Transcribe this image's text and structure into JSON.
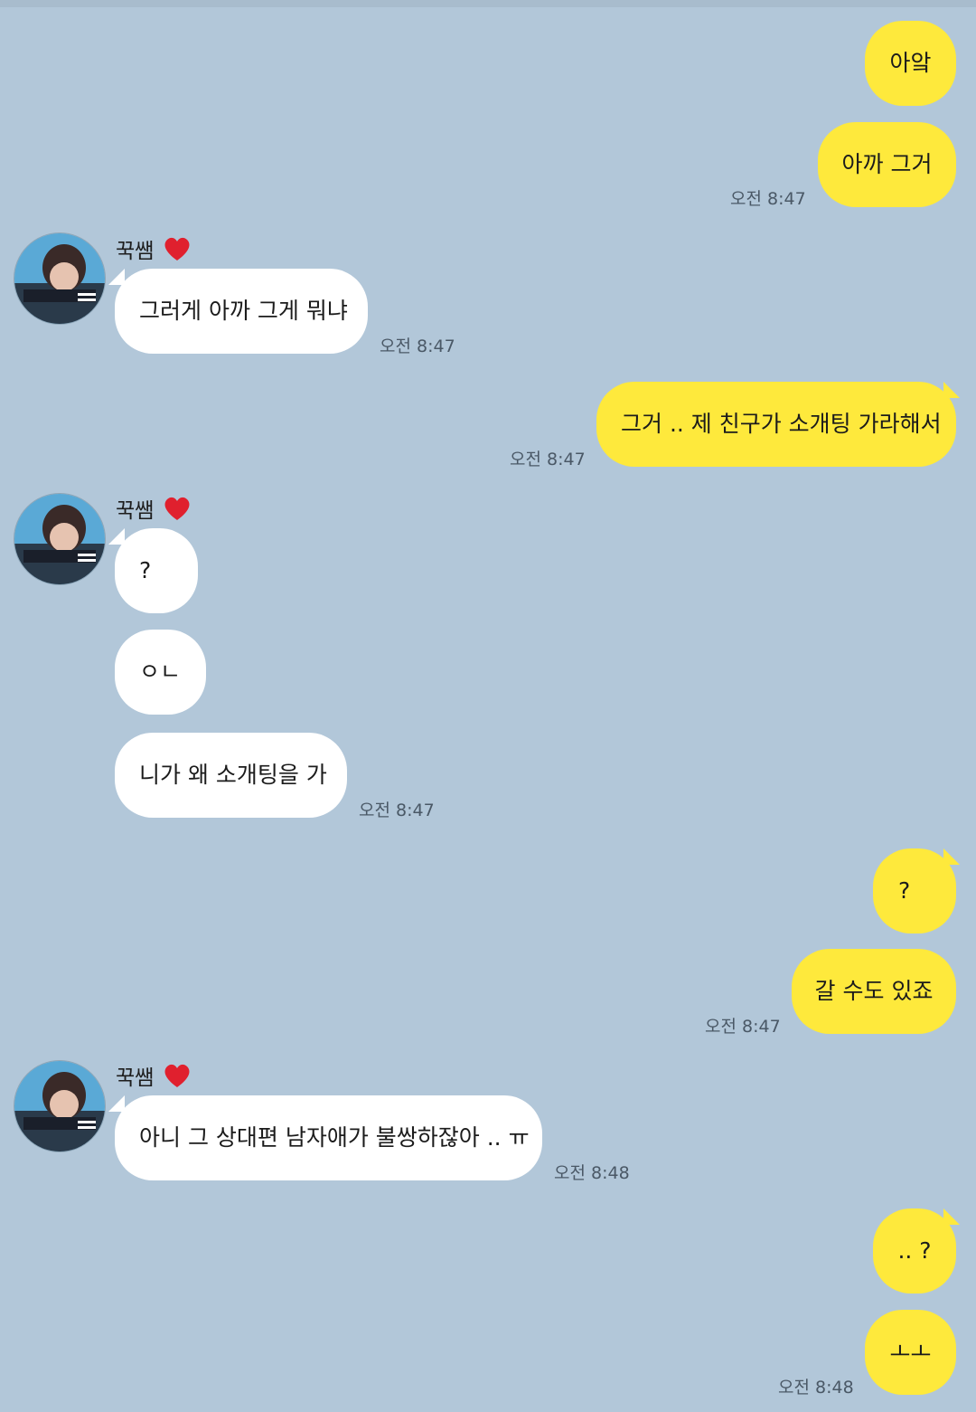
{
  "contact": {
    "name": "꾹쌤",
    "heart": "heart-emoji"
  },
  "colors": {
    "background": "#b2c7d9",
    "my_bubble": "#fee93c",
    "their_bubble": "#ffffff"
  },
  "messages": [
    {
      "from": "me",
      "text": "아앜"
    },
    {
      "from": "me",
      "text": "아까 그거",
      "time": "오전 8:47"
    },
    {
      "from": "them",
      "text": "그러게 아까 그게 뭐냐",
      "time": "오전 8:47"
    },
    {
      "from": "me",
      "text": "그거 .. 제 친구가 소개팅 가라해서",
      "time": "오전 8:47"
    },
    {
      "from": "them",
      "text": "?"
    },
    {
      "from": "them",
      "text": "ㅇㄴ"
    },
    {
      "from": "them",
      "text": "니가 왜 소개팅을 가",
      "time": "오전 8:47"
    },
    {
      "from": "me",
      "text": "?"
    },
    {
      "from": "me",
      "text": "갈 수도 있죠",
      "time": "오전 8:47"
    },
    {
      "from": "them",
      "text": "아니 그 상대편 남자애가 불쌍하잖아 .. ㅠ",
      "time": "오전 8:48"
    },
    {
      "from": "me",
      "text": ".. ?"
    },
    {
      "from": "me",
      "text": "ㅗㅗ",
      "time": "오전 8:48"
    }
  ]
}
